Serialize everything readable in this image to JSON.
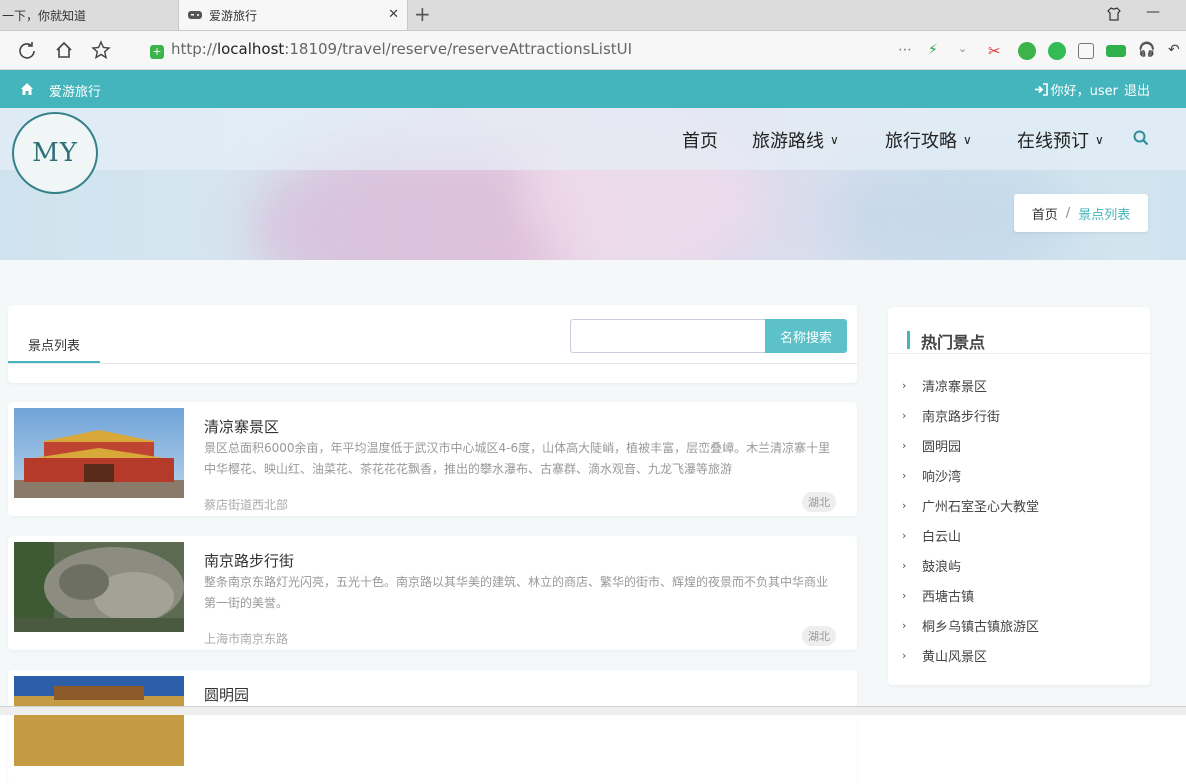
{
  "browser": {
    "tabs": [
      {
        "label": "一下，你就知道",
        "active": false
      },
      {
        "label": "爱游旅行",
        "active": true
      }
    ],
    "url_prefix": "http://",
    "url_host": "localhost",
    "url_rest": ":18109/travel/reserve/reserveAttractionsListUI"
  },
  "topbar": {
    "brand": "爱游旅行",
    "greeting": "你好，user",
    "logout": "退出"
  },
  "logo_text": "MY",
  "nav": {
    "items": [
      {
        "label": "首页",
        "dropdown": false
      },
      {
        "label": "旅游路线",
        "dropdown": true
      },
      {
        "label": "旅行攻略",
        "dropdown": true
      },
      {
        "label": "在线预订",
        "dropdown": true
      }
    ]
  },
  "breadcrumb": {
    "home": "首页",
    "separator": "/",
    "current": "景点列表"
  },
  "list_panel": {
    "tab": "景点列表",
    "search_placeholder": "",
    "search_button": "名称搜索"
  },
  "attractions": [
    {
      "name": "清凉寨景区",
      "desc": "景区总面积6000余亩，年平均温度低于武汉市中心城区4-6度，山体高大陡峭，植被丰富，层峦叠嶂。木兰清凉寨十里中华樱花、映山红、油菜花、茶花花花飘香，推出的攀水瀑布、古寨群、滴水观音、九龙飞瀑等旅游",
      "address": "蔡店街道西北部",
      "region": "湖北"
    },
    {
      "name": "南京路步行街",
      "desc": "整条南京东路灯光闪亮，五光十色。南京路以其华美的建筑、林立的商店、繁华的街市、辉煌的夜景而不负其中华商业第一街的美誉。",
      "address": "上海市南京东路",
      "region": "湖北"
    },
    {
      "name": "圆明园",
      "desc": "",
      "address": "",
      "region": ""
    }
  ],
  "sidebar": {
    "title": "热门景点",
    "items": [
      "清凉寨景区",
      "南京路步行街",
      "圆明园",
      "响沙湾",
      "广州石室圣心大教堂",
      "白云山",
      "鼓浪屿",
      "西塘古镇",
      "桐乡乌镇古镇旅游区",
      "黄山风景区"
    ]
  },
  "colors": {
    "accent": "#44b5bc",
    "button": "#5cc1c8"
  }
}
